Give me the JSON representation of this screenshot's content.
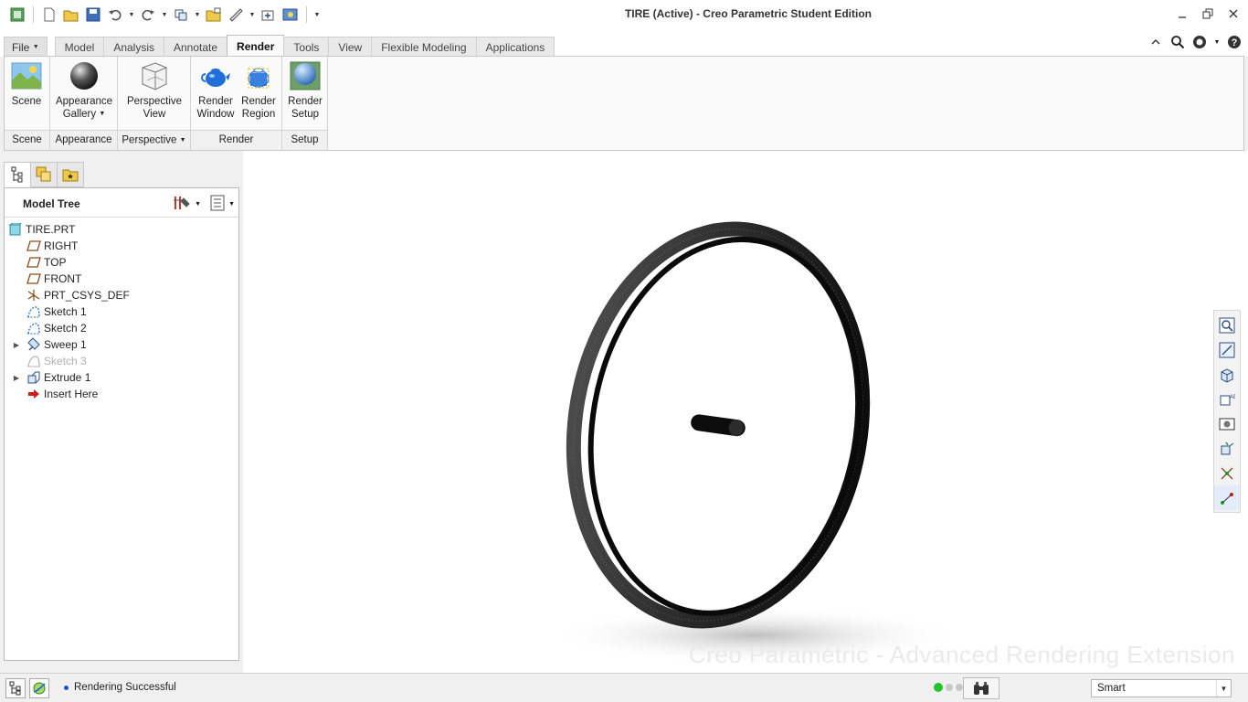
{
  "window": {
    "title": "TIRE (Active) - Creo Parametric Student Edition"
  },
  "quick_access": {
    "icons": [
      "new-icon",
      "open-icon",
      "save-icon",
      "undo-icon",
      "redo-icon",
      "regenerate-icon",
      "window-icon",
      "measure-icon",
      "repaint-icon",
      "render-icon",
      "customize-icon"
    ]
  },
  "menu_tabs": [
    {
      "label": "File",
      "dropdown": true
    },
    {
      "label": "Model"
    },
    {
      "label": "Analysis"
    },
    {
      "label": "Annotate"
    },
    {
      "label": "Render",
      "active": true
    },
    {
      "label": "Tools"
    },
    {
      "label": "View"
    },
    {
      "label": "Flexible Modeling"
    },
    {
      "label": "Applications"
    }
  ],
  "ribbon": {
    "groups": [
      {
        "label": "Scene",
        "buttons": [
          {
            "line1": "Scene",
            "line2": ""
          }
        ]
      },
      {
        "label": "Appearance",
        "buttons": [
          {
            "line1": "Appearance",
            "line2": "Gallery"
          }
        ]
      },
      {
        "label": "Perspective",
        "buttons": [
          {
            "line1": "Perspective",
            "line2": "View"
          }
        ]
      },
      {
        "label": "Render",
        "buttons": [
          {
            "line1": "Render",
            "line2": "Window"
          },
          {
            "line1": "Render",
            "line2": "Region"
          }
        ]
      },
      {
        "label": "Setup",
        "buttons": [
          {
            "line1": "Render",
            "line2": "Setup"
          }
        ]
      }
    ]
  },
  "model_tree": {
    "header": "Model Tree",
    "nodes": [
      {
        "label": "TIRE.PRT",
        "icon": "part-icon"
      },
      {
        "label": "RIGHT",
        "icon": "datum-plane-icon"
      },
      {
        "label": "TOP",
        "icon": "datum-plane-icon"
      },
      {
        "label": "FRONT",
        "icon": "datum-plane-icon"
      },
      {
        "label": "PRT_CSYS_DEF",
        "icon": "coordinate-system-icon"
      },
      {
        "label": "Sketch 1",
        "icon": "sketch-icon"
      },
      {
        "label": "Sketch 2",
        "icon": "sketch-icon"
      },
      {
        "label": "Sweep 1",
        "icon": "sweep-icon",
        "expandable": true
      },
      {
        "label": "Sketch 3",
        "icon": "sketch-icon",
        "hidden": true
      },
      {
        "label": "Extrude 1",
        "icon": "extrude-icon",
        "expandable": true
      },
      {
        "label": "Insert Here",
        "icon": "insert-arrow-icon"
      }
    ]
  },
  "viewport": {
    "watermark": "Creo Parametric - Advanced Rendering Extension",
    "background": "#ffffff"
  },
  "status_bar": {
    "message": "Rendering Successful",
    "filter_value": "Smart"
  },
  "colors": {
    "accent_message_dot": "#1b4fd1",
    "status_light": "#22c32b",
    "datum_plane": "#8a4a1a"
  }
}
